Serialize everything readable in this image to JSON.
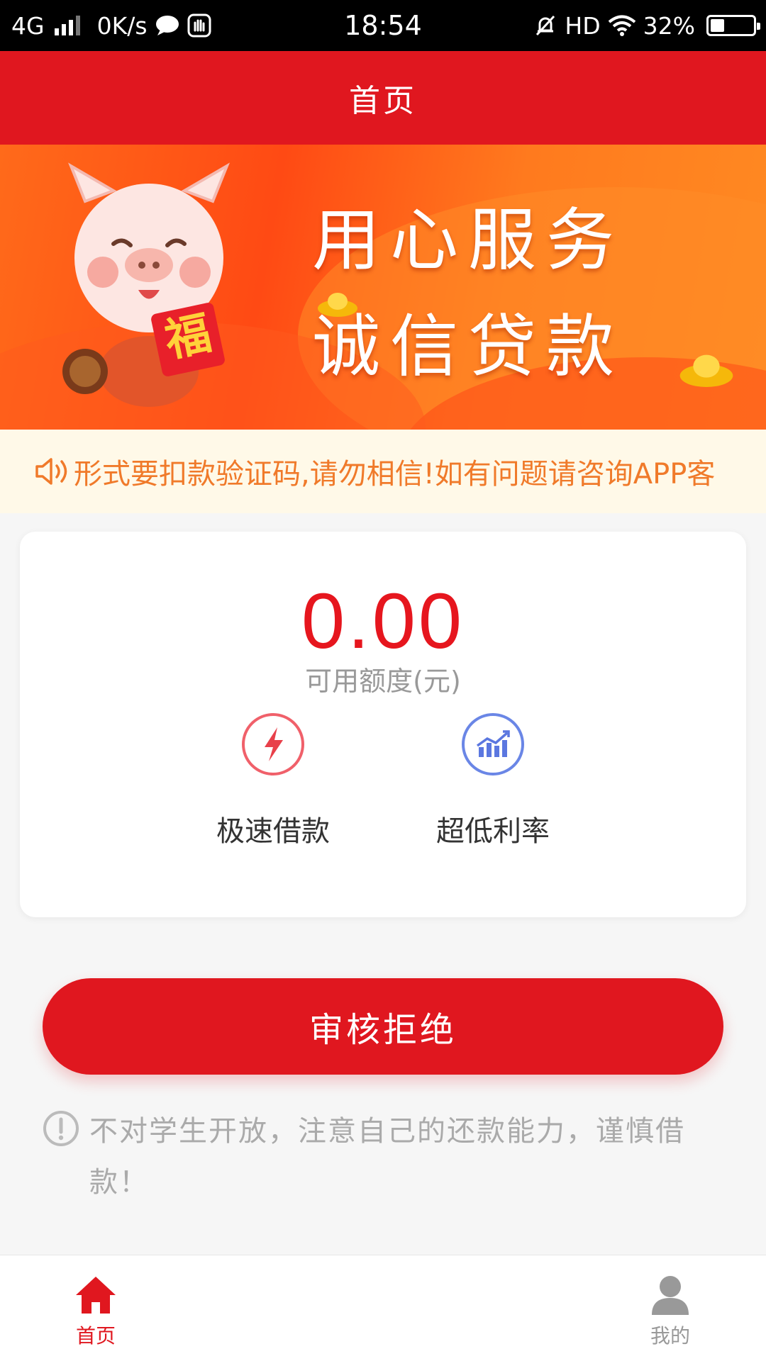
{
  "status_bar": {
    "network": "4G",
    "speed": "0K/s",
    "time": "18:54",
    "hd": "HD",
    "battery": "32%",
    "battery_level": 0.32
  },
  "header": {
    "title": "首页"
  },
  "banner": {
    "line1": "用心服务",
    "line2": "诚信贷款",
    "badge": "福"
  },
  "notice": {
    "text": "形式要扣款验证码,请勿相信!如有问题请咨询APP客"
  },
  "card": {
    "amount": "0.00",
    "amount_label": "可用额度(元)",
    "features": [
      {
        "label": "极速借款",
        "icon": "lightning-icon"
      },
      {
        "label": "超低利率",
        "icon": "trend-chart-icon"
      }
    ]
  },
  "action": {
    "label": "审核拒绝"
  },
  "warning": {
    "text": "不对学生开放，注意自己的还款能力，谨慎借款！"
  },
  "tabbar": {
    "tabs": [
      {
        "label": "首页",
        "icon": "home-icon",
        "active": true
      },
      {
        "label": "我的",
        "icon": "user-icon",
        "active": false
      }
    ]
  },
  "colors": {
    "primary_red": "#e0171f",
    "notice_orange": "#f07a2a",
    "notice_bg": "#fff9e8"
  }
}
